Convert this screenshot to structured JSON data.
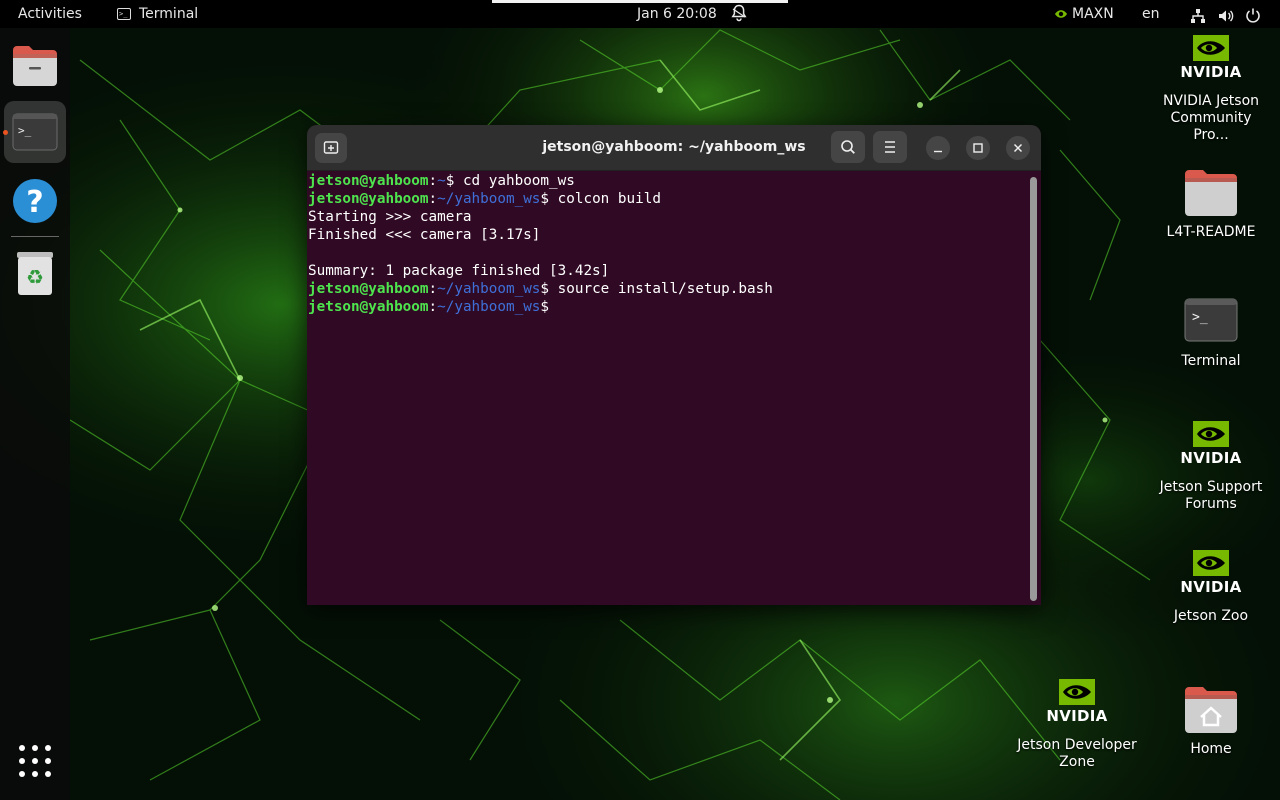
{
  "topbar": {
    "activities": "Activities",
    "app_name": "Terminal",
    "clock": "Jan 6  20:08",
    "power_mode": "MAXN",
    "language": "en"
  },
  "dock": {
    "items": [
      "files-icon",
      "terminal-icon",
      "help-icon",
      "trash-icon",
      "show-apps-icon"
    ],
    "active_app": "terminal"
  },
  "terminal": {
    "title": "jetson@yahboom: ~/yahboom_ws",
    "lines": [
      {
        "user": "jetson@yahboom",
        "path": "~",
        "cmd": " cd yahboom_ws"
      },
      {
        "user": "jetson@yahboom",
        "path": "~/yahboom_ws",
        "cmd": " colcon build"
      },
      {
        "text": "Starting >>> camera"
      },
      {
        "text": "Finished <<< camera [3.17s]"
      },
      {
        "text": ""
      },
      {
        "text": "Summary: 1 package finished [3.42s]"
      },
      {
        "user": "jetson@yahboom",
        "path": "~/yahboom_ws",
        "cmd": " source install/setup.bash"
      },
      {
        "user": "jetson@yahboom",
        "path": "~/yahboom_ws",
        "cmd": ""
      }
    ]
  },
  "desktop": {
    "nvidia_wordmark": "NVIDIA",
    "icons": [
      {
        "label": "NVIDIA Jetson Community Pro...",
        "type": "nvidia"
      },
      {
        "label": "L4T-README",
        "type": "folder"
      },
      {
        "label": "Terminal",
        "type": "terminal"
      },
      {
        "label": "Jetson Support Forums",
        "type": "nvidia"
      },
      {
        "label": "Jetson Zoo",
        "type": "nvidia"
      },
      {
        "label": "Jetson Developer Zone",
        "type": "nvidia"
      },
      {
        "label": "Home",
        "type": "home-folder"
      }
    ]
  },
  "colors": {
    "terminal_bg": "#300a24",
    "prompt_user": "#4ee44e",
    "prompt_path": "#3f6fd8",
    "accent": "#e95420",
    "nvidia_green": "#76b900"
  }
}
